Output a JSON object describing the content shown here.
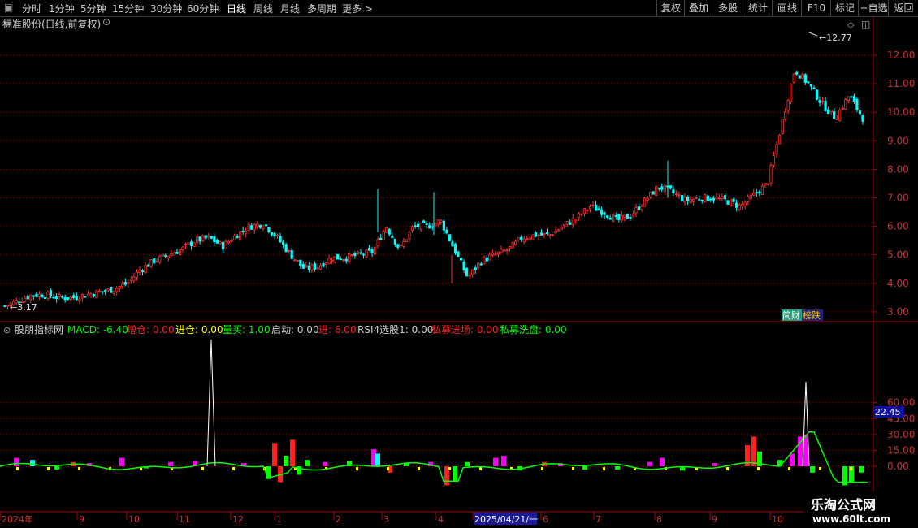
{
  "toolbar": {
    "period_tabs": [
      "分时",
      "1分钟",
      "5分钟",
      "15分钟",
      "30分钟",
      "60分钟",
      "日线",
      "周线",
      "月线",
      "多周期",
      "更多"
    ],
    "active_tab": "日线",
    "right_buttons": [
      "复权",
      "叠加",
      "多股",
      "统计",
      "画线",
      "F10",
      "标记",
      "+自选",
      "返回"
    ]
  },
  "main_panel": {
    "title": "标准股份(日线,前复权)",
    "high_marker": "12.77",
    "low_marker": "3.17",
    "badge_left": "简",
    "badge_mid": "财",
    "badge_right": "榜跌",
    "y_ticks": [
      "12.00",
      "11.00",
      "10.00",
      "9.00",
      "8.00",
      "7.00",
      "6.00",
      "5.00",
      "4.00",
      "3.00"
    ]
  },
  "indicator_panel": {
    "name": "股朋指标网",
    "values": [
      {
        "label": "MACD: -6.40",
        "color": "#00ff00"
      },
      {
        "label": "增仓: 0.00",
        "color": "#ff2020"
      },
      {
        "label": "进仓: 0.00",
        "color": "#ffff00"
      },
      {
        "label": "量买: 1.00",
        "color": "#00ff00"
      },
      {
        "label": "启动: 0.00",
        "color": "#d0d0d0"
      },
      {
        "label": "进: 6.00",
        "color": "#ff2020"
      },
      {
        "label": "RSI4选股1: 0.00",
        "color": "#d0d0d0"
      },
      {
        "label": "私募进场: 0.00",
        "color": "#ff2020"
      },
      {
        "label": "私募洗盘: 0.00",
        "color": "#00ff00"
      }
    ],
    "y_ticks": [
      "60.00",
      "45.00",
      "30.00",
      "15.00",
      "0.00"
    ],
    "current_value": "22.45"
  },
  "x_axis": {
    "labels": [
      "2024年",
      "9",
      "10",
      "11",
      "12",
      "1",
      "2",
      "3",
      "4",
      "2025/04/21/一",
      "6",
      "7",
      "8",
      "9",
      "10"
    ]
  },
  "watermark": {
    "title": "乐淘公式网",
    "url": "www.60lt.com"
  },
  "colors": {
    "up": "#ff3030",
    "down": "#00ffff",
    "grid": "#8b0000",
    "axis": "#b00000"
  },
  "chart_data": {
    "type": "candlestick",
    "x_range": [
      "2024-08",
      "2025-10"
    ],
    "price_range": [
      3.0,
      12.77
    ],
    "series_close": [
      3.2,
      3.4,
      3.6,
      3.6,
      3.5,
      3.5,
      3.6,
      3.7,
      3.8,
      4.0,
      4.5,
      4.8,
      5.0,
      5.2,
      5.5,
      5.6,
      5.3,
      5.7,
      6.0,
      6.1,
      5.6,
      5.0,
      4.5,
      4.6,
      4.9,
      4.9,
      5.0,
      5.1,
      6.0,
      5.2,
      6.0,
      6.0,
      6.2,
      5.2,
      4.2,
      4.8,
      5.0,
      5.2,
      5.6,
      5.7,
      5.7,
      6.0,
      6.3,
      6.7,
      6.5,
      6.2,
      6.4,
      6.9,
      7.4,
      7.2,
      6.9,
      7.0,
      7.0,
      6.9,
      6.7,
      7.1,
      7.5,
      9.5,
      11.5,
      11.0,
      10.3,
      9.8,
      10.6,
      9.8
    ]
  }
}
